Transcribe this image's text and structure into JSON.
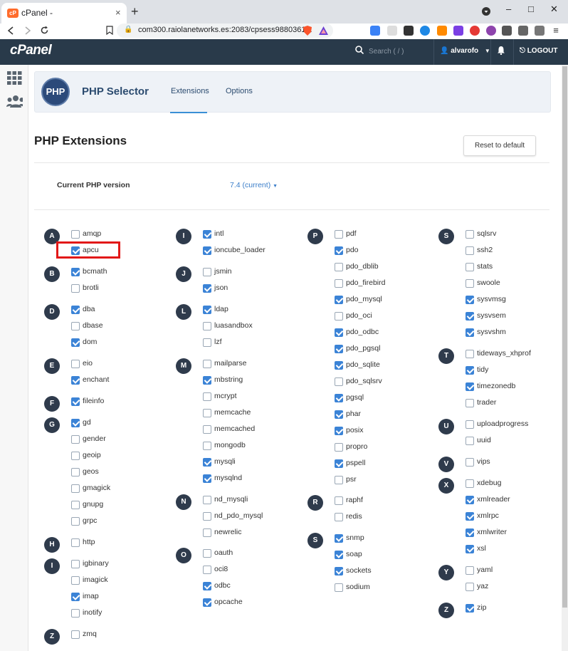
{
  "browser": {
    "tab_title": "cPanel -",
    "tab_close": "×",
    "new_tab": "+",
    "url": "com300.raiolanetworks.es:2083/cpsess9880361...",
    "controls": [
      "–",
      "□",
      "✕"
    ],
    "fav_text": "cP"
  },
  "header": {
    "logo": "cPanel",
    "search_placeholder": "Search ( / )",
    "user": "alvarofo",
    "logout": "LOGOUT"
  },
  "page": {
    "title": "PHP Selector",
    "logo_text": "PHP",
    "tabs": [
      "Extensions",
      "Options"
    ],
    "section_title": "PHP Extensions",
    "reset_label": "Reset to default",
    "current_php_label": "Current PHP version",
    "current_php_value": "7.4 (current)"
  },
  "extensions": [
    {
      "letter": "A",
      "items": [
        {
          "name": "amqp",
          "checked": false
        },
        {
          "name": "apcu",
          "checked": true
        }
      ]
    },
    {
      "letter": "B",
      "items": [
        {
          "name": "bcmath",
          "checked": true
        },
        {
          "name": "brotli",
          "checked": false
        }
      ]
    },
    {
      "letter": "D",
      "items": [
        {
          "name": "dba",
          "checked": true
        },
        {
          "name": "dbase",
          "checked": false
        },
        {
          "name": "dom",
          "checked": true
        }
      ]
    },
    {
      "letter": "E",
      "items": [
        {
          "name": "eio",
          "checked": false
        },
        {
          "name": "enchant",
          "checked": true
        }
      ]
    },
    {
      "letter": "F",
      "items": [
        {
          "name": "fileinfo",
          "checked": true
        }
      ]
    },
    {
      "letter": "G",
      "items": [
        {
          "name": "gd",
          "checked": true
        },
        {
          "name": "gender",
          "checked": false
        },
        {
          "name": "geoip",
          "checked": false
        },
        {
          "name": "geos",
          "checked": false
        },
        {
          "name": "gmagick",
          "checked": false
        },
        {
          "name": "gnupg",
          "checked": false
        },
        {
          "name": "grpc",
          "checked": false
        }
      ]
    },
    {
      "letter": "H",
      "items": [
        {
          "name": "http",
          "checked": false
        }
      ]
    },
    {
      "letter": "I",
      "items": [
        {
          "name": "igbinary",
          "checked": false
        },
        {
          "name": "imagick",
          "checked": false
        },
        {
          "name": "imap",
          "checked": true
        },
        {
          "name": "inotify",
          "checked": false
        }
      ]
    },
    {
      "letter": "Z",
      "items": [
        {
          "name": "zmq",
          "checked": false
        }
      ]
    },
    {
      "letter": "I",
      "items": [
        {
          "name": "intl",
          "checked": true
        },
        {
          "name": "ioncube_loader",
          "checked": true
        }
      ]
    },
    {
      "letter": "J",
      "items": [
        {
          "name": "jsmin",
          "checked": false
        },
        {
          "name": "json",
          "checked": true
        }
      ]
    },
    {
      "letter": "L",
      "items": [
        {
          "name": "ldap",
          "checked": true
        },
        {
          "name": "luasandbox",
          "checked": false
        },
        {
          "name": "lzf",
          "checked": false
        }
      ]
    },
    {
      "letter": "M",
      "items": [
        {
          "name": "mailparse",
          "checked": false
        },
        {
          "name": "mbstring",
          "checked": true
        },
        {
          "name": "mcrypt",
          "checked": false
        },
        {
          "name": "memcache",
          "checked": false
        },
        {
          "name": "memcached",
          "checked": false
        },
        {
          "name": "mongodb",
          "checked": false
        },
        {
          "name": "mysqli",
          "checked": true
        },
        {
          "name": "mysqlnd",
          "checked": true
        }
      ]
    },
    {
      "letter": "N",
      "items": [
        {
          "name": "nd_mysqli",
          "checked": false
        },
        {
          "name": "nd_pdo_mysql",
          "checked": false
        },
        {
          "name": "newrelic",
          "checked": false
        }
      ]
    },
    {
      "letter": "O",
      "items": [
        {
          "name": "oauth",
          "checked": false
        },
        {
          "name": "oci8",
          "checked": false
        },
        {
          "name": "odbc",
          "checked": true
        },
        {
          "name": "opcache",
          "checked": true
        }
      ]
    },
    {
      "letter": "P",
      "items": [
        {
          "name": "pdf",
          "checked": false
        },
        {
          "name": "pdo",
          "checked": true
        },
        {
          "name": "pdo_dblib",
          "checked": false
        },
        {
          "name": "pdo_firebird",
          "checked": false
        },
        {
          "name": "pdo_mysql",
          "checked": true
        },
        {
          "name": "pdo_oci",
          "checked": false
        },
        {
          "name": "pdo_odbc",
          "checked": true
        },
        {
          "name": "pdo_pgsql",
          "checked": true
        },
        {
          "name": "pdo_sqlite",
          "checked": true
        },
        {
          "name": "pdo_sqlsrv",
          "checked": false
        },
        {
          "name": "pgsql",
          "checked": true
        },
        {
          "name": "phar",
          "checked": true
        },
        {
          "name": "posix",
          "checked": true
        },
        {
          "name": "propro",
          "checked": false
        },
        {
          "name": "pspell",
          "checked": true
        },
        {
          "name": "psr",
          "checked": false
        }
      ]
    },
    {
      "letter": "R",
      "items": [
        {
          "name": "raphf",
          "checked": false
        },
        {
          "name": "redis",
          "checked": false
        }
      ]
    },
    {
      "letter": "S",
      "items": [
        {
          "name": "snmp",
          "checked": true
        },
        {
          "name": "soap",
          "checked": true
        },
        {
          "name": "sockets",
          "checked": true
        },
        {
          "name": "sodium",
          "checked": false
        }
      ]
    },
    {
      "letter": "S",
      "items": [
        {
          "name": "sqlsrv",
          "checked": false
        },
        {
          "name": "ssh2",
          "checked": false
        },
        {
          "name": "stats",
          "checked": false
        },
        {
          "name": "swoole",
          "checked": false
        },
        {
          "name": "sysvmsg",
          "checked": true
        },
        {
          "name": "sysvsem",
          "checked": true
        },
        {
          "name": "sysvshm",
          "checked": true
        }
      ]
    },
    {
      "letter": "T",
      "items": [
        {
          "name": "tideways_xhprof",
          "checked": false
        },
        {
          "name": "tidy",
          "checked": true
        },
        {
          "name": "timezonedb",
          "checked": true
        },
        {
          "name": "trader",
          "checked": false
        }
      ]
    },
    {
      "letter": "U",
      "items": [
        {
          "name": "uploadprogress",
          "checked": false
        },
        {
          "name": "uuid",
          "checked": false
        }
      ]
    },
    {
      "letter": "V",
      "items": [
        {
          "name": "vips",
          "checked": false
        }
      ]
    },
    {
      "letter": "X",
      "items": [
        {
          "name": "xdebug",
          "checked": false
        },
        {
          "name": "xmlreader",
          "checked": true
        },
        {
          "name": "xmlrpc",
          "checked": true
        },
        {
          "name": "xmlwriter",
          "checked": true
        },
        {
          "name": "xsl",
          "checked": true
        }
      ]
    },
    {
      "letter": "Y",
      "items": [
        {
          "name": "yaml",
          "checked": false
        },
        {
          "name": "yaz",
          "checked": false
        }
      ]
    },
    {
      "letter": "Z",
      "items": [
        {
          "name": "zip",
          "checked": true
        }
      ]
    }
  ],
  "highlighted_extension": "apcu"
}
